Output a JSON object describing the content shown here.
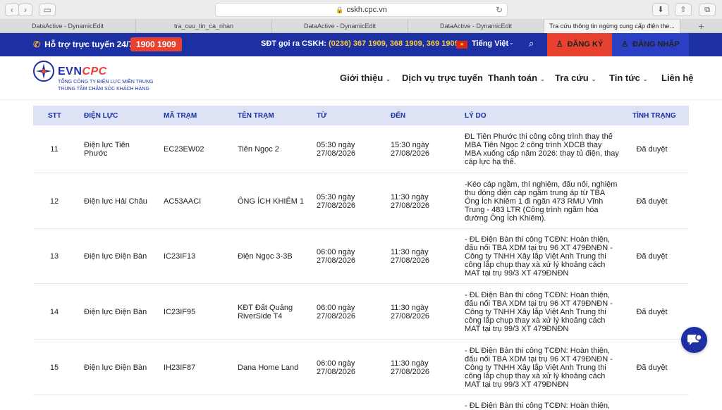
{
  "browser": {
    "url": "cskh.cpc.vn",
    "tabs": [
      "DataActive - DynamicEdit",
      "tra_cuu_tin_ca_nhan",
      "DataActive - DynamicEdit",
      "DataActive - DynamicEdit",
      "Tra cứu thông tin ngừng cung cấp điện the..."
    ],
    "active_tab": 4
  },
  "topbar": {
    "support_label": "Hỗ trợ trực tuyến 24/7:",
    "hotline": "1900 1909",
    "cskh_label": "SĐT gọi ra CSKH:",
    "cskh_numbers": "(0236) 367 1909, 368 1909, 369 1909",
    "language": "Tiếng Việt",
    "register": "ĐĂNG KÝ",
    "login": "ĐĂNG NHẬP"
  },
  "header": {
    "brand_evn": "EVN",
    "brand_cpc": "CPC",
    "tagline1": "TỔNG CÔNG TY ĐIỆN LỰC MIỀN TRUNG",
    "tagline2": "TRUNG TÂM CHĂM SÓC KHÁCH HÀNG",
    "menu": [
      "Giới thiệu",
      "Dịch vụ trực tuyến",
      "Thanh toán",
      "Tra cứu",
      "Tin tức",
      "Liên hệ"
    ]
  },
  "table": {
    "headers": [
      "STT",
      "ĐIỆN LỰC",
      "MÃ TRẠM",
      "TÊN TRẠM",
      "TỪ",
      "ĐẾN",
      "LÝ DO",
      "TÌNH TRẠNG"
    ],
    "rows": [
      {
        "stt": "11",
        "dl": "Điện lực Tiên Phước",
        "ma": "EC23EW02",
        "ten": "Tiên Ngọc 2",
        "tu": "05:30 ngày 27/08/2026",
        "den": "15:30 ngày 27/08/2026",
        "ly": "ĐL Tiên Phước thi công công trình thay thế MBA Tiên Ngọc 2 công trình XDCB thay MBA xuống cấp năm 2026: thay tủ điện, thay cáp lực hạ thế.",
        "tt": "Đã duyệt"
      },
      {
        "stt": "12",
        "dl": "Điện lực Hải Châu",
        "ma": "AC53AACI",
        "ten": "ÔNG ÍCH KHIÊM 1",
        "tu": "05:30 ngày 27/08/2026",
        "den": "11:30 ngày 27/08/2026",
        "ly": "-Kéo cáp ngầm, thí nghiệm, đấu nối, nghiệm thu đóng điện cáp ngầm trung áp từ TBA Ông Ích Khiêm 1 đi ngăn 473 RMU Vĩnh Trung - 483 LTR (Công trình ngầm hóa đường Ông Ích Khiêm).",
        "tt": "Đã duyệt"
      },
      {
        "stt": "13",
        "dl": "Điện lực Điện Bàn",
        "ma": "IC23IF13",
        "ten": "Điện Ngọc 3-3B",
        "tu": "06:00 ngày 27/08/2026",
        "den": "11:30 ngày 27/08/2026",
        "ly": "- ĐL Điện Bàn thi công TCĐN: Hoàn thiện, đấu nối TBA XDM tại trụ 96 XT 479ĐNĐN - Công ty TNHH Xây lắp Việt Anh Trung thi công lắp chụp thay xà xử lý khoảng cách MAT tại trụ 99/3 XT 479ĐNĐN",
        "tt": "Đã duyệt"
      },
      {
        "stt": "14",
        "dl": "Điện lực Điện Bàn",
        "ma": "IC23IF95",
        "ten": "KĐT Đất Quảng RiverSide T4",
        "tu": "06:00 ngày 27/08/2026",
        "den": "11:30 ngày 27/08/2026",
        "ly": "- ĐL Điện Bàn thi công TCĐN: Hoàn thiện, đấu nối TBA XDM tại trụ 96 XT 479ĐNĐN - Công ty TNHH Xây lắp Việt Anh Trung thi công lắp chụp thay xà xử lý khoảng cách MAT tại trụ 99/3 XT 479ĐNĐN",
        "tt": "Đã duyệt"
      },
      {
        "stt": "15",
        "dl": "Điện lực Điện Bàn",
        "ma": "IH23IF87",
        "ten": "Dana Home Land",
        "tu": "06:00 ngày 27/08/2026",
        "den": "11:30 ngày 27/08/2026",
        "ly": "- ĐL Điện Bàn thi công TCĐN: Hoàn thiện, đấu nối TBA XDM tại trụ 96 XT 479ĐNĐN - Công ty TNHH Xây lắp Việt Anh Trung thi công lắp chụp thay xà xử lý khoảng cách MAT tại trụ 99/3 XT 479ĐNĐN",
        "tt": "Đã duyệt"
      }
    ],
    "partial_row_ly": "- ĐL Điện Bàn thi công TCĐN: Hoàn thiện,"
  },
  "colors": {
    "primary": "#1c2fa3",
    "accent": "#e8412f"
  }
}
